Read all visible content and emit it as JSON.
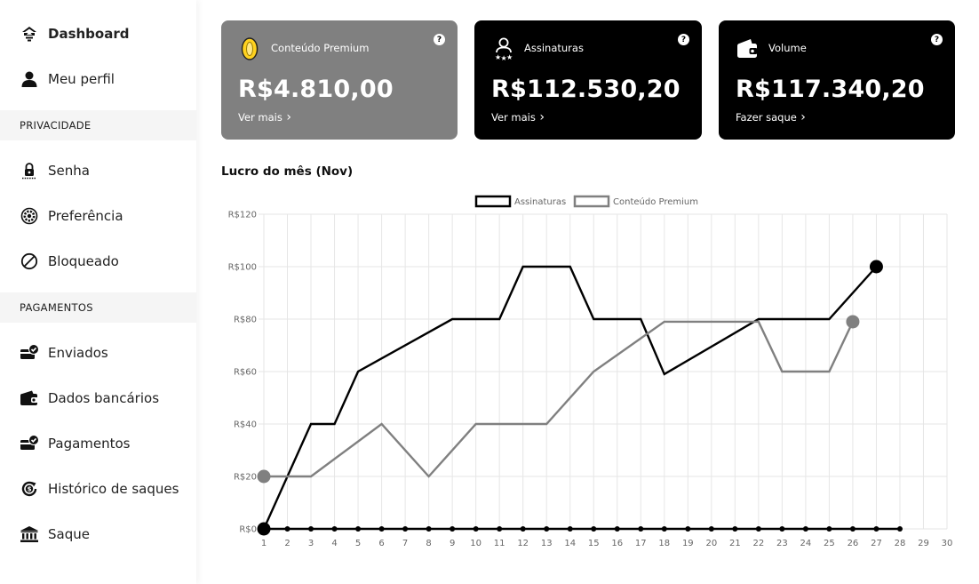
{
  "sidebar": {
    "items": [
      {
        "label": "Dashboard",
        "icon": "dashboard-icon",
        "active": true
      },
      {
        "label": "Meu perfil",
        "icon": "user-icon"
      }
    ],
    "sections": [
      {
        "header": "PRIVACIDADE",
        "items": [
          {
            "label": "Senha",
            "icon": "lock-icon"
          },
          {
            "label": "Preferência",
            "icon": "gear-icon"
          },
          {
            "label": "Bloqueado",
            "icon": "blocked-icon"
          }
        ]
      },
      {
        "header": "PAGAMENTOS",
        "items": [
          {
            "label": "Enviados",
            "icon": "card-check-icon"
          },
          {
            "label": "Dados bancários",
            "icon": "wallet-icon"
          },
          {
            "label": "Pagamentos",
            "icon": "card-check-icon"
          },
          {
            "label": "Histórico de saques",
            "icon": "money-history-icon"
          },
          {
            "label": "Saque",
            "icon": "bank-icon"
          }
        ]
      }
    ]
  },
  "cards": [
    {
      "title": "Conteúdo Premium",
      "amount": "R$4.810,00",
      "link": "Ver mais",
      "bg": "#808080",
      "icon": "coin-icon",
      "help": "?"
    },
    {
      "title": "Assinaturas",
      "amount": "R$112.530,20",
      "link": "Ver mais",
      "bg": "#000000",
      "icon": "subscribers-icon",
      "help": "?"
    },
    {
      "title": "Volume",
      "amount": "R$117.340,20",
      "link": "Fazer saque",
      "bg": "#000000",
      "icon": "wallet-icon",
      "help": "?"
    }
  ],
  "chart_title": "Lucro do mês (Nov)",
  "chart_data": {
    "type": "line",
    "title": "Lucro do mês (Nov)",
    "x": [
      1,
      2,
      3,
      4,
      5,
      6,
      7,
      8,
      9,
      10,
      11,
      12,
      13,
      14,
      15,
      16,
      17,
      18,
      19,
      20,
      21,
      22,
      23,
      24,
      25,
      26,
      27,
      28,
      29,
      30
    ],
    "ylim": [
      0,
      120
    ],
    "yticks": [
      "R$0",
      "R$20",
      "R$40",
      "R$60",
      "R$80",
      "R$100",
      "R$120"
    ],
    "ytick_values": [
      0,
      20,
      40,
      60,
      80,
      100,
      120
    ],
    "grid": true,
    "legend": "top-center",
    "series": [
      {
        "name": "Assinaturas",
        "color": "#000000",
        "points": [
          [
            1,
            0
          ],
          [
            3,
            40
          ],
          [
            4,
            40
          ],
          [
            5,
            60
          ],
          [
            9,
            80
          ],
          [
            11,
            80
          ],
          [
            12,
            100
          ],
          [
            14,
            100
          ],
          [
            15,
            80
          ],
          [
            17,
            80
          ],
          [
            18,
            59
          ],
          [
            22,
            80
          ],
          [
            25,
            80
          ],
          [
            27,
            100
          ]
        ],
        "end_marker_x": 27
      },
      {
        "name": "Conteúdo Premium",
        "color": "#808080",
        "points": [
          [
            1,
            20
          ],
          [
            3,
            20
          ],
          [
            6,
            40
          ],
          [
            8,
            20
          ],
          [
            10,
            40
          ],
          [
            13,
            40
          ],
          [
            15,
            60
          ],
          [
            18,
            79
          ],
          [
            22,
            79
          ],
          [
            23,
            60
          ],
          [
            25,
            60
          ],
          [
            26,
            79
          ]
        ],
        "end_marker_x": 26
      },
      {
        "name": "",
        "color": "#000000",
        "points": [
          [
            1,
            0
          ],
          [
            2,
            0
          ],
          [
            3,
            0
          ],
          [
            4,
            0
          ],
          [
            5,
            0
          ],
          [
            6,
            0
          ],
          [
            7,
            0
          ],
          [
            8,
            0
          ],
          [
            9,
            0
          ],
          [
            10,
            0
          ],
          [
            11,
            0
          ],
          [
            12,
            0
          ],
          [
            13,
            0
          ],
          [
            14,
            0
          ],
          [
            15,
            0
          ],
          [
            16,
            0
          ],
          [
            17,
            0
          ],
          [
            18,
            0
          ],
          [
            19,
            0
          ],
          [
            20,
            0
          ],
          [
            21,
            0
          ],
          [
            22,
            0
          ],
          [
            23,
            0
          ],
          [
            24,
            0
          ],
          [
            25,
            0
          ],
          [
            26,
            0
          ],
          [
            27,
            0
          ],
          [
            28,
            0
          ]
        ],
        "markers": true
      }
    ]
  }
}
